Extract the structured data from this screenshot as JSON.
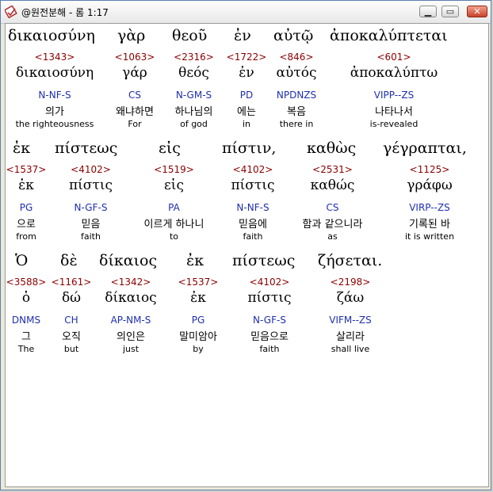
{
  "window": {
    "title": "@원전분해 - 롬 1:17",
    "icon": "app-stamp-icon"
  },
  "controls": {
    "minimize": "▁",
    "maximize": "▭",
    "close": "✕"
  },
  "rows": [
    {
      "greek": [
        "δικαιοσύνη",
        "γὰρ",
        "θεοῦ",
        "ἐν",
        "αὐτῷ",
        "ἀποκαλύπτεται"
      ],
      "words": [
        {
          "num": "<1343>",
          "lemma": "δικαιοσύνη",
          "parse": "N-NF-S",
          "ko": "의가",
          "en": "the righteousness"
        },
        {
          "num": "<1063>",
          "lemma": "γάρ",
          "parse": "CS",
          "ko": "왜냐하면",
          "en": "For"
        },
        {
          "num": "<2316>",
          "lemma": "θεός",
          "parse": "N-GM-S",
          "ko": "하나님의",
          "en": "of god"
        },
        {
          "num": "<1722>",
          "lemma": "ἐν",
          "parse": "PD",
          "ko": "에는",
          "en": "in"
        },
        {
          "num": "<846>",
          "lemma": "αὐτός",
          "parse": "NPDNZS",
          "ko": "복음",
          "en": "there in"
        },
        {
          "num": "<601>",
          "lemma": "ἀποκαλύπτω",
          "parse": "VIPP--ZS",
          "ko": "나타나서",
          "en": "is-revealed"
        }
      ]
    },
    {
      "greek": [
        "ἐκ",
        "πίστεως",
        "εἰς",
        "πίστιν,",
        "καθὼς",
        "γέγραπται,"
      ],
      "words": [
        {
          "num": "<1537>",
          "lemma": "ἐκ",
          "parse": "PG",
          "ko": "으로",
          "en": "from"
        },
        {
          "num": "<4102>",
          "lemma": "πίστις",
          "parse": "N-GF-S",
          "ko": "믿음",
          "en": "faith"
        },
        {
          "num": "<1519>",
          "lemma": "εἰς",
          "parse": "PA",
          "ko": "이르게 하나니",
          "en": "to"
        },
        {
          "num": "<4102>",
          "lemma": "πίστις",
          "parse": "N-NF-S",
          "ko": "믿음에",
          "en": "faith"
        },
        {
          "num": "<2531>",
          "lemma": "καθώς",
          "parse": "CS",
          "ko": "함과 같으니라",
          "en": "as"
        },
        {
          "num": "<1125>",
          "lemma": "γράφω",
          "parse": "VIRP--ZS",
          "ko": "기록된 바",
          "en": "it is written"
        }
      ]
    },
    {
      "greek": [
        "Ὁ",
        "δὲ",
        "δίκαιος",
        "ἐκ",
        "πίστεως",
        "ζήσεται."
      ],
      "words": [
        {
          "num": "<3588>",
          "lemma": "ὁ",
          "parse": "DNMS",
          "ko": "그",
          "en": "The"
        },
        {
          "num": "<1161>",
          "lemma": "δώ",
          "parse": "CH",
          "ko": "오직",
          "en": "but"
        },
        {
          "num": "<1342>",
          "lemma": "δίκαιος",
          "parse": "AP-NM-S",
          "ko": "의인은",
          "en": "just"
        },
        {
          "num": "<1537>",
          "lemma": "ἐκ",
          "parse": "PG",
          "ko": "말미암아",
          "en": "by"
        },
        {
          "num": "<4102>",
          "lemma": "πίστις",
          "parse": "N-GF-S",
          "ko": "믿음으로",
          "en": "faith"
        },
        {
          "num": "<2198>",
          "lemma": "ζάω",
          "parse": "VIFM--ZS",
          "ko": "살리라",
          "en": "shall live"
        }
      ]
    }
  ]
}
